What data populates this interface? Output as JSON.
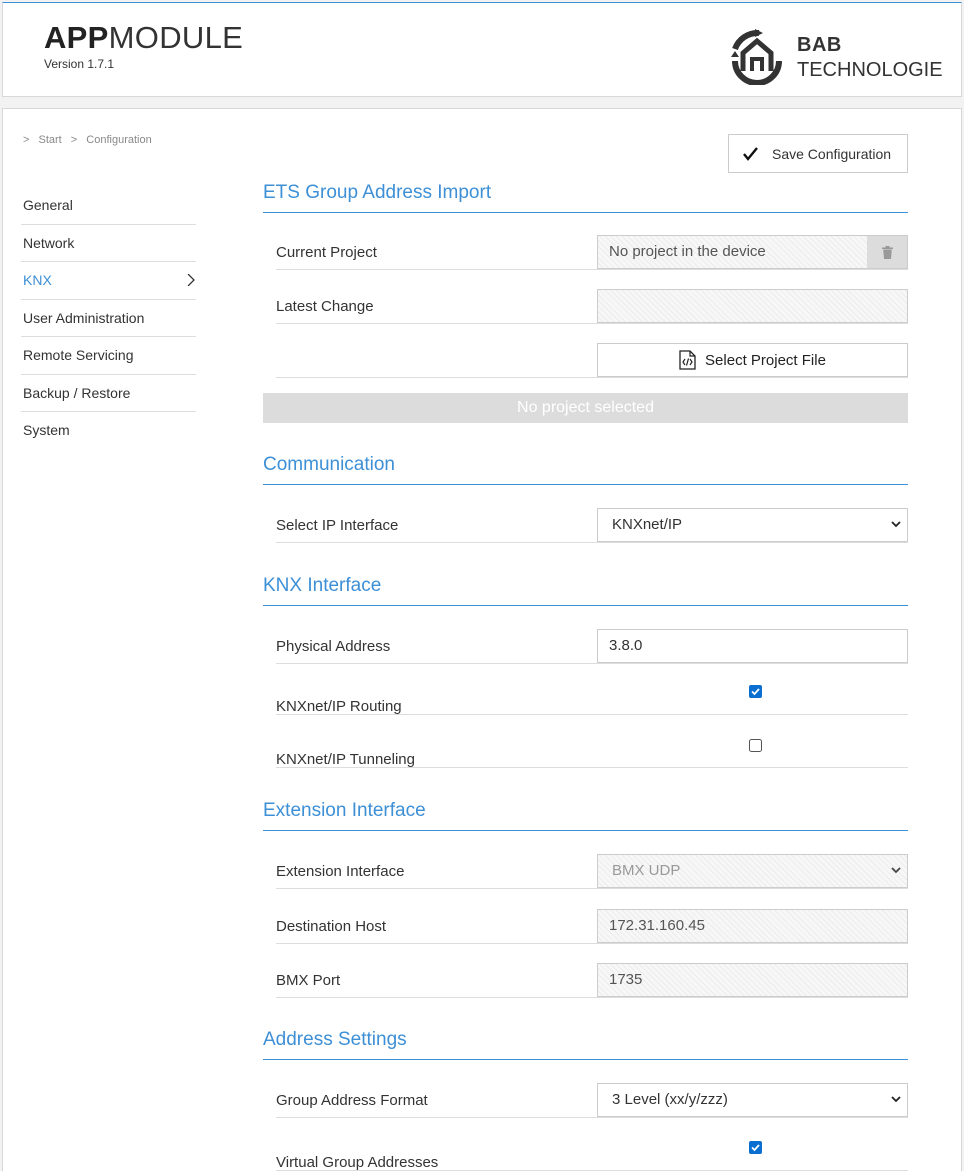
{
  "header": {
    "app_title_bold": "APP",
    "app_title_light": "MODULE",
    "version": "Version 1.7.1",
    "logo_line1": "BAB",
    "logo_line2": "TECHNOLOGIE"
  },
  "breadcrumb": {
    "sep": ">",
    "start": "Start",
    "current": "Configuration"
  },
  "sidebar": {
    "items": [
      {
        "label": "General"
      },
      {
        "label": "Network"
      },
      {
        "label": "KNX"
      },
      {
        "label": "User Administration"
      },
      {
        "label": "Remote Servicing"
      },
      {
        "label": "Backup / Restore"
      },
      {
        "label": "System"
      }
    ]
  },
  "toolbar": {
    "save_label": "Save Configuration"
  },
  "ets": {
    "title": "ETS Group Address Import",
    "current_project_label": "Current Project",
    "current_project_value": "No project in the device",
    "latest_change_label": "Latest Change",
    "latest_change_value": "",
    "select_file_label": "Select Project File",
    "status": "No project selected"
  },
  "communication": {
    "title": "Communication",
    "ip_interface_label": "Select IP Interface",
    "ip_interface_value": "KNXnet/IP"
  },
  "knx_interface": {
    "title": "KNX Interface",
    "physical_address_label": "Physical Address",
    "physical_address_value": "3.8.0",
    "routing_label": "KNXnet/IP Routing",
    "routing_checked": true,
    "tunneling_label": "KNXnet/IP Tunneling",
    "tunneling_checked": false
  },
  "extension": {
    "title": "Extension Interface",
    "interface_label": "Extension Interface",
    "interface_value": "BMX UDP",
    "dest_host_label": "Destination Host",
    "dest_host_value": "172.31.160.45",
    "port_label": "BMX Port",
    "port_value": "1735"
  },
  "address": {
    "title": "Address Settings",
    "format_label": "Group Address Format",
    "format_value": "3 Level (xx/y/zzz)",
    "virtual_label": "Virtual Group Addresses",
    "virtual_checked": true
  },
  "colors": {
    "accent": "#3d8fd6",
    "brand_dark": "#333333"
  }
}
